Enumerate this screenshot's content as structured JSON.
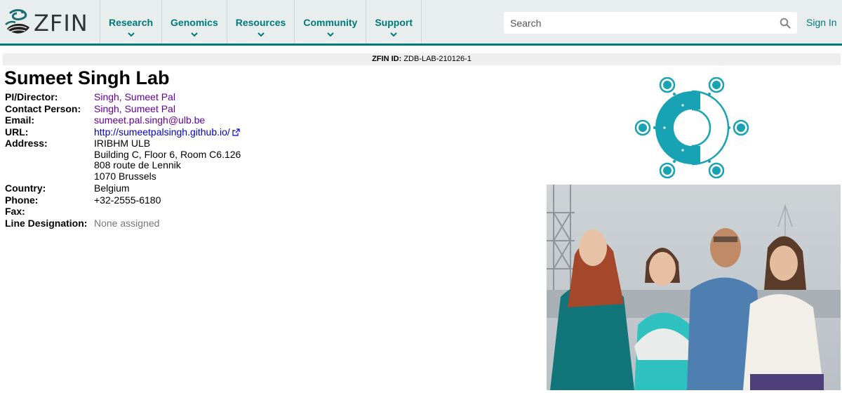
{
  "header": {
    "logo_text": "ZFIN",
    "nav": [
      {
        "label": "Research"
      },
      {
        "label": "Genomics"
      },
      {
        "label": "Resources"
      },
      {
        "label": "Community"
      },
      {
        "label": "Support"
      }
    ],
    "search_placeholder": "Search",
    "sign_in": "Sign In",
    "accent_color": "#00797a"
  },
  "id_bar": {
    "label": "ZFIN ID:",
    "value": "ZDB-LAB-210126-1"
  },
  "lab": {
    "title": "Sumeet Singh Lab",
    "fields": {
      "pi_label": "PI/Director:",
      "pi_value": "Singh, Sumeet Pal",
      "contact_label": "Contact Person:",
      "contact_value": "Singh, Sumeet Pal",
      "email_label": "Email:",
      "email_value": "sumeet.pal.singh@ulb.be",
      "url_label": "URL:",
      "url_value": "http://sumeetpalsingh.github.io/",
      "address_label": "Address:",
      "address_lines": [
        "IRIBHM ULB",
        "Building C, Floor 6, Room C6.126",
        "808 route de Lennik",
        "1070 Brussels"
      ],
      "country_label": "Country:",
      "country_value": "Belgium",
      "phone_label": "Phone:",
      "phone_value": "+32-2555-6180",
      "fax_label": "Fax:",
      "fax_value": "",
      "line_label": "Line Designation:",
      "line_value": "None assigned"
    }
  },
  "icons": {
    "logo": "zfin-fish-logo-icon",
    "chevron": "chevron-down-icon",
    "search": "search-icon",
    "external": "external-link-icon",
    "lab_logo": "lab-logo-icon"
  },
  "colors": {
    "link": "#660099",
    "url_link": "#0000cc",
    "lab_logo_teal": "#17a3b4"
  }
}
